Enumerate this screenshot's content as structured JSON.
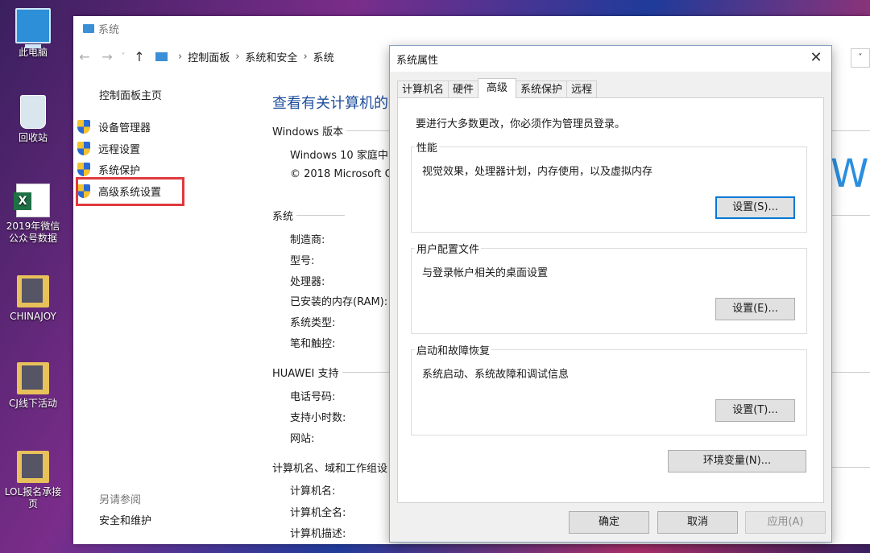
{
  "desktop": {
    "icons": [
      {
        "label": "此电脑"
      },
      {
        "label": "回收站"
      },
      {
        "label": "2019年微信公众号数据"
      },
      {
        "label": "CHINAJOY"
      },
      {
        "label": "CJ线下活动"
      },
      {
        "label": "LOL报名承接页"
      }
    ]
  },
  "explorer": {
    "title": "系统",
    "breadcrumb": [
      "控制面板",
      "系统和安全",
      "系统"
    ],
    "left_nav": {
      "home": "控制面板主页",
      "items": [
        "设备管理器",
        "远程设置",
        "系统保护",
        "高级系统设置"
      ],
      "see_also": "另请参阅",
      "see_also_link": "安全和维护"
    },
    "main": {
      "heading": "查看有关计算机的基",
      "windows_section": "Windows 版本",
      "windows_edition": "Windows 10 家庭中",
      "copyright": "© 2018 Microsoft C",
      "system_section": "系统",
      "system_rows": [
        "制造商:",
        "型号:",
        "处理器:",
        "已安装的内存(RAM):",
        "系统类型:",
        "笔和触控:"
      ],
      "huawei_section": "HUAWEI 支持",
      "huawei_rows": [
        "电话号码:",
        "支持小时数:",
        "网站:"
      ],
      "computer_section": "计算机名、域和工作组设",
      "computer_rows": [
        "计算机名:",
        "计算机全名:",
        "计算机描述:"
      ],
      "logo_fragment": "W"
    }
  },
  "dialog": {
    "title": "系统属性",
    "tabs": [
      "计算机名",
      "硬件",
      "高级",
      "系统保护",
      "远程"
    ],
    "active_tab": "高级",
    "intro": "要进行大多数更改，你必须作为管理员登录。",
    "groups": [
      {
        "title": "性能",
        "desc": "视觉效果，处理器计划，内存使用，以及虚拟内存",
        "button": "设置(S)..."
      },
      {
        "title": "用户配置文件",
        "desc": "与登录帐户相关的桌面设置",
        "button": "设置(E)..."
      },
      {
        "title": "启动和故障恢复",
        "desc": "系统启动、系统故障和调试信息",
        "button": "设置(T)..."
      }
    ],
    "env_button": "环境变量(N)...",
    "ok": "确定",
    "cancel": "取消",
    "apply": "应用(A)"
  }
}
